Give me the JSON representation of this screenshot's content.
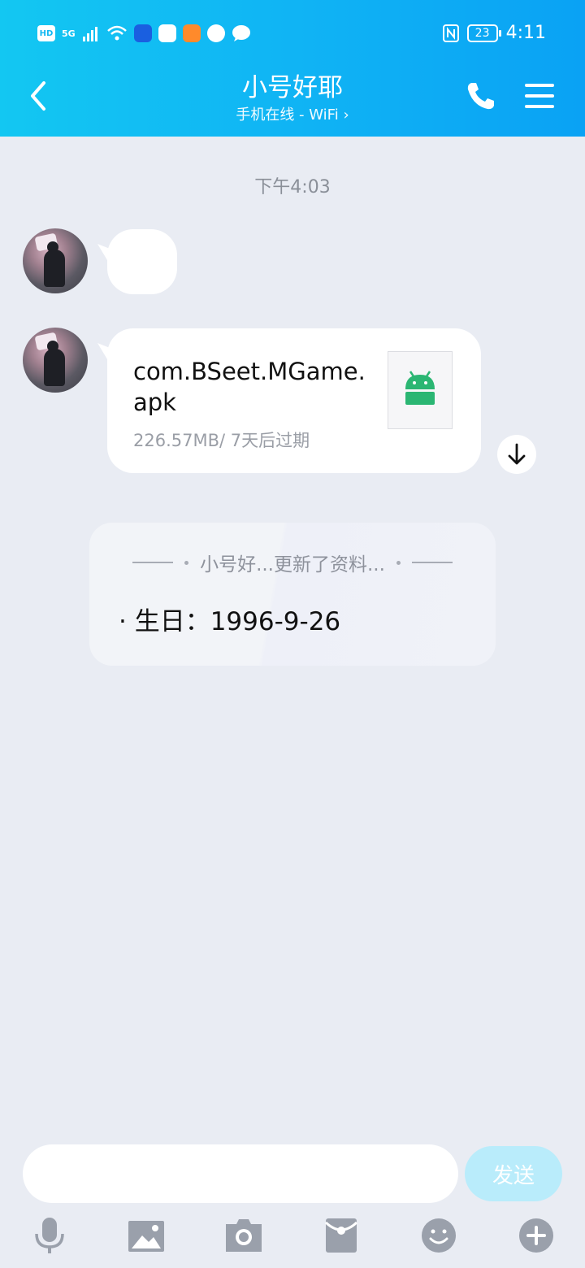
{
  "status_bar": {
    "left_badges": [
      "HD",
      "5G"
    ],
    "time": "4:11",
    "battery": "23"
  },
  "header": {
    "title": "小号好耶",
    "subtitle": "手机在线 - WiFi"
  },
  "chat": {
    "timestamp": "下午4:03",
    "file_message": {
      "name": "com.BSeet.MGame.apk",
      "meta": "226.57MB/ 7天后过期"
    },
    "profile_update": {
      "header": "小号好...更新了资料...",
      "item": "· 生日：1996-9-26"
    }
  },
  "input": {
    "send_label": "发送"
  },
  "toolbar": {
    "icons": [
      "microphone-icon",
      "image-icon",
      "camera-icon",
      "red-packet-icon",
      "emoji-icon",
      "plus-icon"
    ]
  },
  "colors": {
    "header_start": "#13c7f2",
    "header_end": "#0aa2f4",
    "background": "#e9ecf3",
    "android_green": "#2bb673",
    "send_disabled": "#b9ecfb"
  }
}
